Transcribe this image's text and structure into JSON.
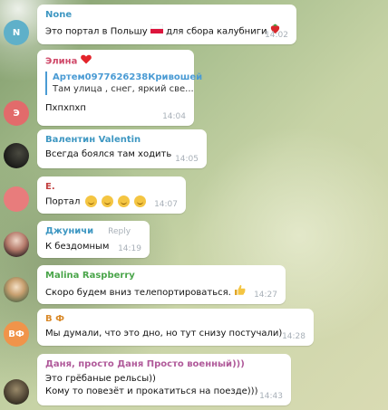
{
  "messages": [
    {
      "sender": "None",
      "text": "Это портал в Польшу",
      "text_after": "для сбора калубниги",
      "time": "14:02",
      "avatar": "N",
      "avatar_color": "#5fb0c9",
      "sender_color": "#3e97c2"
    },
    {
      "sender": "Элина",
      "text": "Пхпхпхп",
      "time": "14:04",
      "avatar": "Э",
      "avatar_color": "#e26b6b",
      "sender_color": "#d04a6a",
      "quote": {
        "name": "Артем0977626238Кривошей",
        "text": "Там улица , снег, яркий све..."
      }
    },
    {
      "sender": "Валентин Valentin",
      "text": "Всегда боялся там ходить",
      "time": "14:05",
      "sender_color": "#3e97c2"
    },
    {
      "sender": "E.",
      "text": "Портал",
      "time": "14:07",
      "avatar_color": "#e87c7c",
      "sender_color": "#c24040"
    },
    {
      "sender": "Джуничи",
      "reply_label": "Reply",
      "text": "К бездомным",
      "time": "14:19",
      "sender_color": "#3e97c2"
    },
    {
      "sender": "Malina Raspberry",
      "text": "Скоро будем вниз телепортироваться.",
      "time": "14:27",
      "sender_color": "#4aa54a"
    },
    {
      "sender": "В Ф",
      "text": "Мы думали, что это дно, но тут снизу постучали)",
      "time": "14:28",
      "avatar": "ВФ",
      "avatar_color": "#f0944a",
      "sender_color": "#d98a2b"
    },
    {
      "sender": "Даня, просто Даня Просто военный)))",
      "text": "Это грёбаные рельсы))",
      "text2": "Кому то повезёт и прокатиться на поезде)))",
      "time": "14:43",
      "sender_color": "#b05a9a"
    }
  ]
}
